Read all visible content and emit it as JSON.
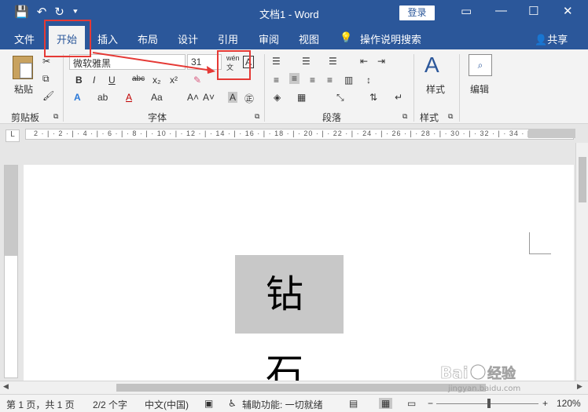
{
  "titlebar": {
    "doc_title": "文档1  -  Word",
    "login": "登录",
    "qat": [
      "💾",
      "↶",
      "↻",
      "⯆"
    ],
    "win_ctrls": [
      "▭",
      "—",
      "☐",
      "✕"
    ]
  },
  "tabs": [
    {
      "label": "文件"
    },
    {
      "label": "开始"
    },
    {
      "label": "插入"
    },
    {
      "label": "布局"
    },
    {
      "label": "设计"
    },
    {
      "label": "引用"
    },
    {
      "label": "审阅"
    },
    {
      "label": "视图"
    },
    {
      "label": "操作说明搜索"
    }
  ],
  "share": "共享",
  "ribbon": {
    "paste": "粘贴",
    "font_name": "微软雅黑",
    "font_size": "31",
    "styles": "样式",
    "edit": "编辑",
    "groups": {
      "clipboard": "剪贴板",
      "font": "字体",
      "paragraph": "段落",
      "styles": "样式"
    }
  },
  "document": {
    "text": "钻 石"
  },
  "status": {
    "page": "第 1 页，共 1 页",
    "words": "2/2 个字",
    "lang": "中文(中国)",
    "access": "辅助功能: 一切就绪",
    "zoom": "120%"
  },
  "colors": {
    "accent": "#2b579a",
    "highlight": "#e53935"
  }
}
